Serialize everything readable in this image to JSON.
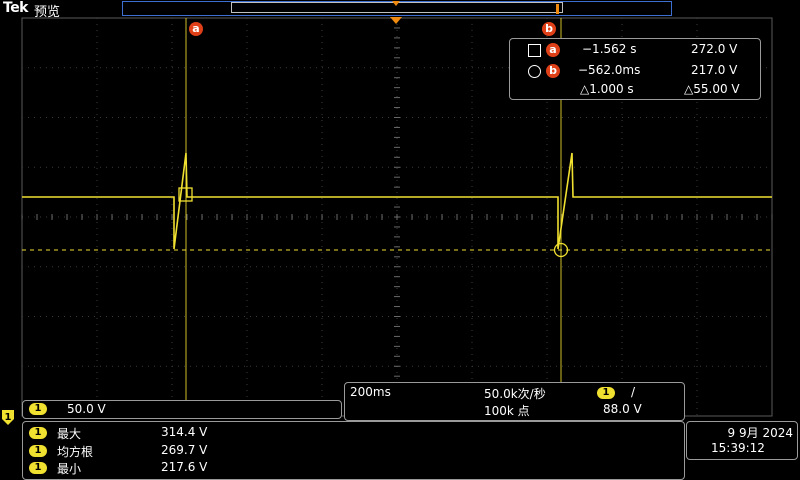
{
  "header": {
    "brand": "Tek",
    "mode": "预览"
  },
  "trigger": {
    "channel": "1"
  },
  "cursor_a": {
    "label": "a",
    "time": "−1.562 s",
    "value": "272.0 V"
  },
  "cursor_b": {
    "label": "b",
    "time": "−562.0ms",
    "value": "217.0 V"
  },
  "delta": {
    "time": "△1.000 s",
    "value": "△55.00 V"
  },
  "channel_scale": {
    "channel": "1",
    "value": "50.0 V"
  },
  "acquisition": {
    "timebase": "200ms",
    "sample_rate": "50.0k次/秒",
    "record_length": "100k 点",
    "trigger_channel": "1",
    "trigger_slope": "/",
    "trigger_level": "88.0 V"
  },
  "measurements": [
    {
      "channel": "1",
      "label": "最大",
      "value": "314.4 V"
    },
    {
      "channel": "1",
      "label": "均方根",
      "value": "269.7 V"
    },
    {
      "channel": "1",
      "label": "最小",
      "value": "217.6 V"
    }
  ],
  "datetime": {
    "date": "9 9月 2024",
    "time": "15:39:12"
  },
  "colors": {
    "trace": "#f0e030",
    "cursor_tag": "#e04018",
    "grid": "#4a4a4a",
    "record_bar": "#3c6fd0",
    "trigger_marker": "#f08a10"
  }
}
